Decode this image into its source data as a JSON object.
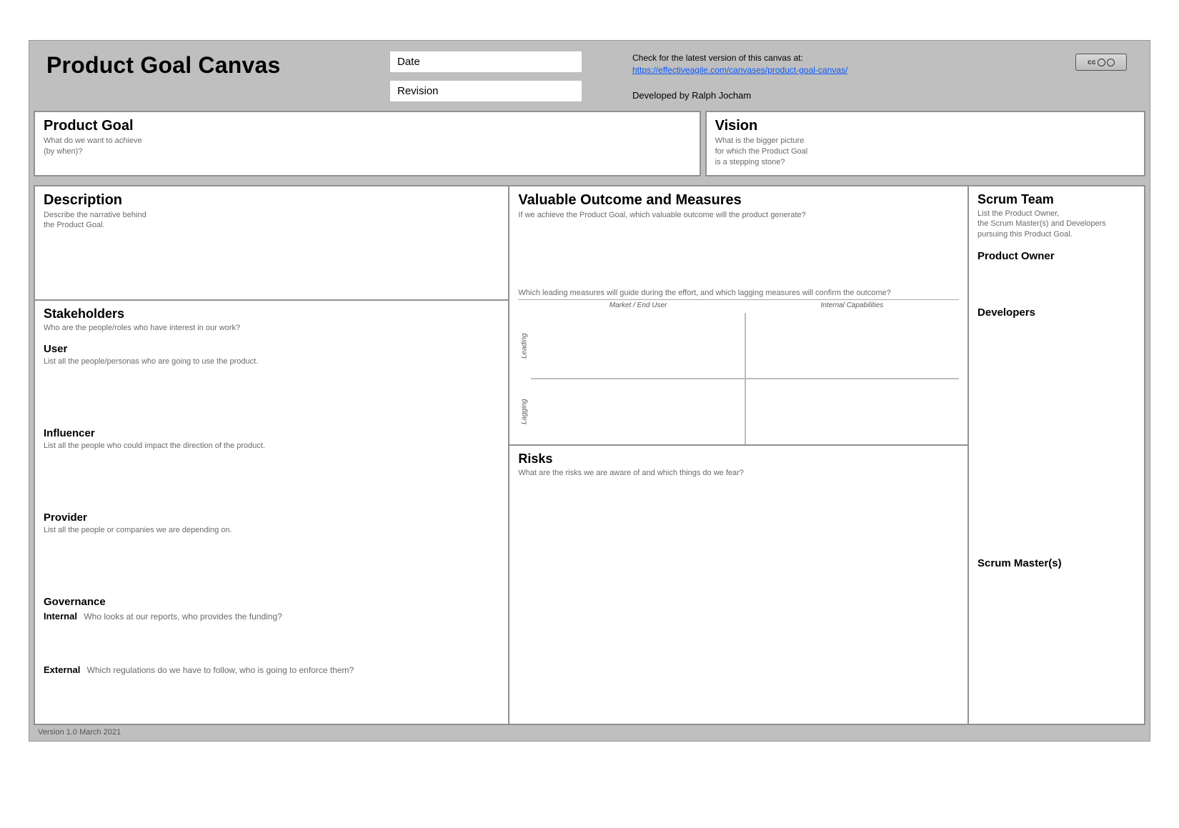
{
  "header": {
    "title": "Product Goal Canvas",
    "date_label": "Date",
    "revision_label": "Revision",
    "check_text": "Check for the latest version of this canvas at:",
    "link_text": "https://effectiveagile.com/canvases/product-goal-canvas/",
    "developed_by": "Developed by Ralph Jocham",
    "cc_label": "cc"
  },
  "product_goal": {
    "title": "Product Goal",
    "sub1": "What do we want to achieve",
    "sub2": "(by when)?"
  },
  "vision": {
    "title": "Vision",
    "sub1": "What is the bigger picture",
    "sub2": "for which the Product Goal",
    "sub3": "is a stepping stone?"
  },
  "description": {
    "title": "Description",
    "sub1": "Describe the narrative behind",
    "sub2": "the Product Goal."
  },
  "stakeholders": {
    "title": "Stakeholders",
    "sub": "Who are the people/roles who have interest in our work?",
    "user_title": "User",
    "user_sub": "List all the people/personas who are going to use the product.",
    "influencer_title": "Influencer",
    "influencer_sub": "List all the people who could impact the direction of the product.",
    "provider_title": "Provider",
    "provider_sub": "List all the people or companies we are depending on.",
    "governance_title": "Governance",
    "gov_internal_label": "Internal",
    "gov_internal_sub": "Who looks at our reports, who provides the funding?",
    "gov_external_label": "External",
    "gov_external_sub": "Which regulations do we have to follow, who is going to enforce them?"
  },
  "outcome": {
    "title": "Valuable Outcome and Measures",
    "sub": "If we achieve the Product Goal, which valuable outcome will the product generate?",
    "matrix_intro": "Which leading measures will guide during the effort, and which lagging measures will confirm the outcome?",
    "col1": "Market / End User",
    "col2": "Internal Capabilities",
    "row1": "Leading",
    "row2": "Lagging"
  },
  "risks": {
    "title": "Risks",
    "sub": "What are the risks we are aware of and which things do we fear?"
  },
  "team": {
    "title": "Scrum Team",
    "sub1": "List the Product Owner,",
    "sub2": "the Scrum Master(s) and Developers",
    "sub3": "pursuing this Product Goal.",
    "po": "Product Owner",
    "dev": "Developers",
    "sm": "Scrum Master(s)"
  },
  "footer": {
    "version": "Version 1.0  March 2021"
  }
}
